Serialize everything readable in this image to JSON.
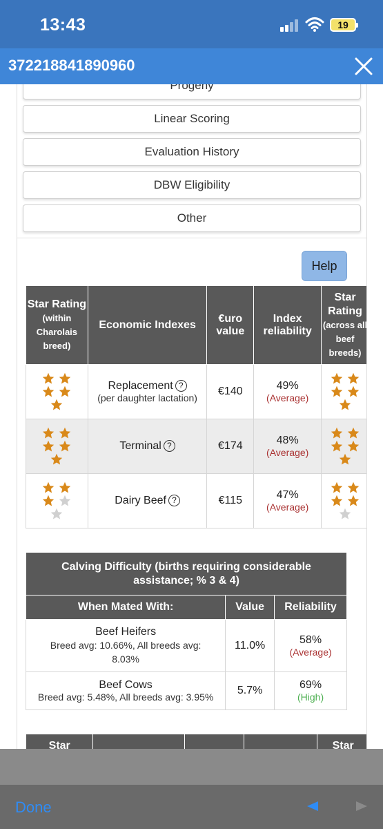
{
  "status": {
    "time": "13:43",
    "battery": "19"
  },
  "header": {
    "title": "372218841890960"
  },
  "menu": [
    "Progeny",
    "Linear Scoring",
    "Evaluation History",
    "DBW Eligibility",
    "Other"
  ],
  "help_label": "Help",
  "economic_table": {
    "headers": {
      "star_within": "Star Rating",
      "star_within_sub": "(within Charolais breed)",
      "indexes": "Economic Indexes",
      "value": "€uro value",
      "reliability": "Index reliability",
      "star_across": "Star Rating",
      "star_across_sub": "(across all beef breeds)"
    },
    "rows": [
      {
        "name": "Replacement",
        "sub": "(per daughter lactation)",
        "value": "€140",
        "reliability": "49%",
        "rel_label": "(Average)",
        "stars_within": 5,
        "stars_across": 5
      },
      {
        "name": "Terminal",
        "sub": "",
        "value": "€174",
        "reliability": "48%",
        "rel_label": "(Average)",
        "stars_within": 5,
        "stars_across": 5
      },
      {
        "name": "Dairy Beef",
        "sub": "",
        "value": "€115",
        "reliability": "47%",
        "rel_label": "(Average)",
        "stars_within": 3,
        "stars_across": 4
      }
    ],
    "help_symbol": "?"
  },
  "calving_table": {
    "title": "Calving Difficulty (births requiring considerable assistance; % 3 & 4)",
    "headers": {
      "mated": "When Mated With:",
      "value": "Value",
      "reliability": "Reliability"
    },
    "rows": [
      {
        "name": "Beef Heifers",
        "sub": "Breed avg: 10.66%, All breeds avg: 8.03%",
        "value": "11.0%",
        "reliability": "58%",
        "rel_label": "(Average)"
      },
      {
        "name": "Beef Cows",
        "sub": "Breed avg: 5.48%, All breeds avg: 3.95%",
        "value": "5.7%",
        "reliability": "69%",
        "rel_label": "(High)"
      }
    ]
  },
  "third_table": {
    "left_header": "Star",
    "right_header": "Star"
  },
  "toolbar": {
    "done": "Done"
  },
  "colors": {
    "status_bar": "#3a75bd",
    "header": "#3f86d8",
    "table_header": "#595959",
    "star_gold": "#d9891a",
    "star_empty": "#d0d0d0",
    "average": "#aa3333",
    "high": "#4caf50",
    "done": "#2f8cf5"
  }
}
